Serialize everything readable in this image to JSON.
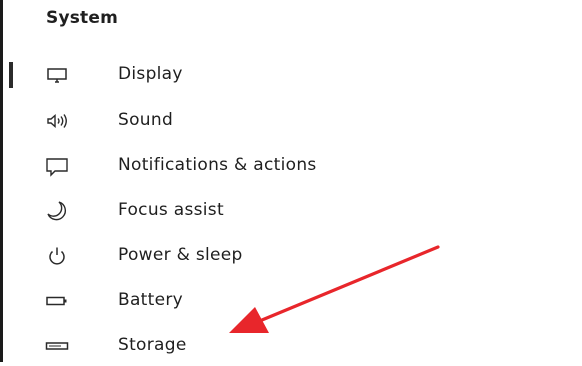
{
  "section": {
    "title": "System"
  },
  "nav": {
    "items": [
      {
        "label": "Display",
        "icon": "monitor-icon"
      },
      {
        "label": "Sound",
        "icon": "speaker-icon"
      },
      {
        "label": "Notifications & actions",
        "icon": "message-icon"
      },
      {
        "label": "Focus assist",
        "icon": "moon-icon"
      },
      {
        "label": "Power & sleep",
        "icon": "power-icon"
      },
      {
        "label": "Battery",
        "icon": "battery-icon"
      },
      {
        "label": "Storage",
        "icon": "storage-drive-icon"
      }
    ]
  },
  "annotation": {
    "color": "#e8262b"
  }
}
